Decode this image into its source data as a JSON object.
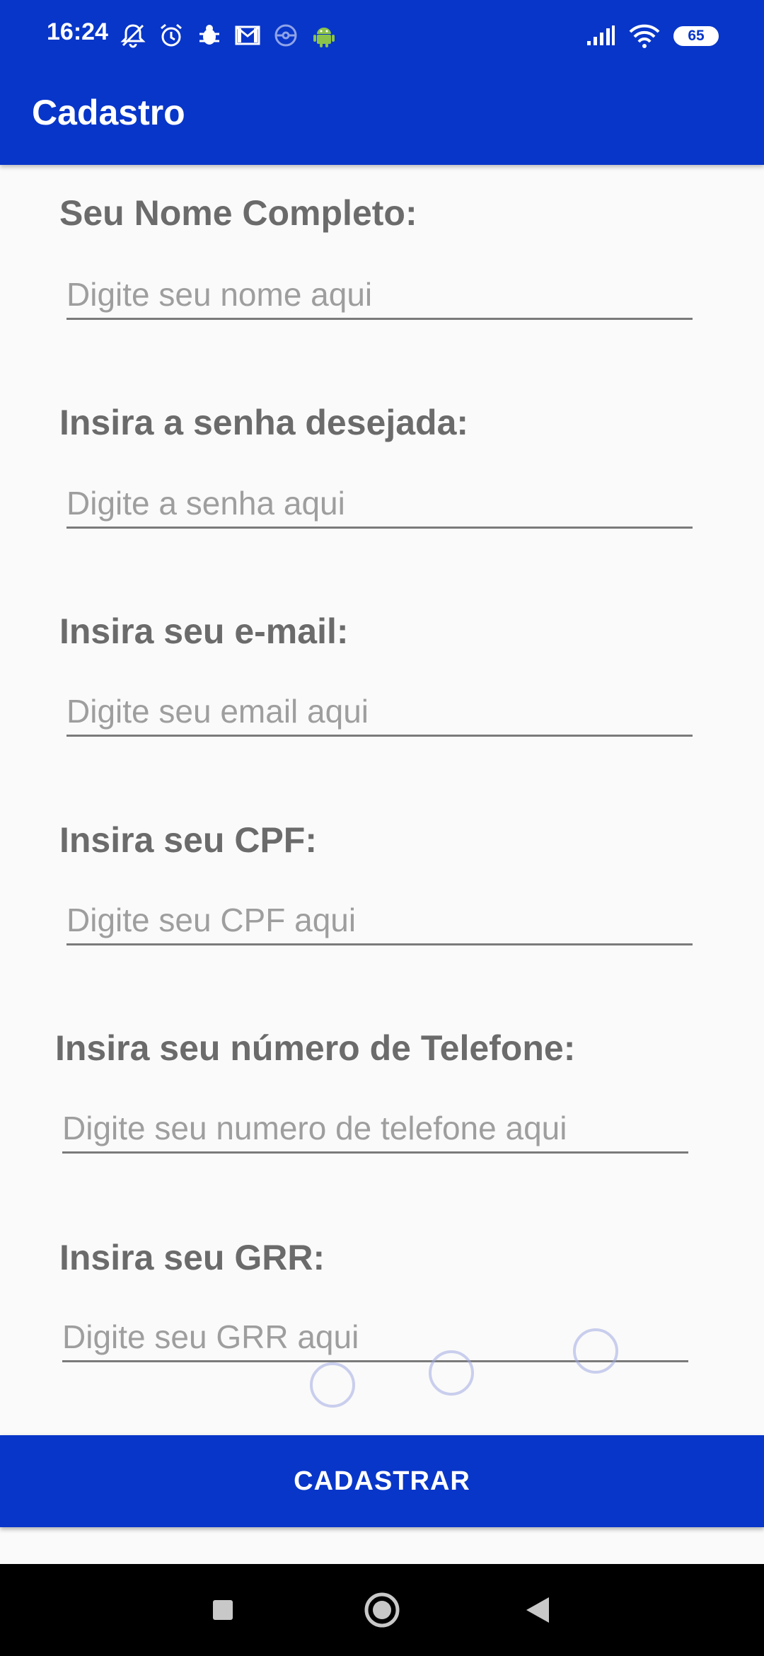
{
  "status_bar": {
    "time": "16:24",
    "left_icons": [
      "mute-icon",
      "alarm-icon",
      "bug-icon",
      "gmail-icon",
      "pokeball-icon",
      "android-icon"
    ],
    "right_icons": [
      "signal-icon",
      "wifi-icon"
    ],
    "battery": "65"
  },
  "app_bar": {
    "title": "Cadastro",
    "color": "#0836c9"
  },
  "form": {
    "fields": [
      {
        "label": "Seu Nome Completo:",
        "placeholder": "Digite seu nome aqui"
      },
      {
        "label": "Insira a senha desejada:",
        "placeholder": "Digite a senha aqui"
      },
      {
        "label": "Insira seu e-mail:",
        "placeholder": "Digite seu email aqui"
      },
      {
        "label": "Insira seu CPF:",
        "placeholder": "Digite seu CPF aqui"
      },
      {
        "label": "Insira seu número de Telefone:",
        "placeholder": "Digite seu numero de telefone aqui"
      },
      {
        "label": "Insira seu GRR:",
        "placeholder": "Digite seu GRR aqui"
      }
    ],
    "submit_label": "CADASTRAR"
  },
  "nav_bar": {
    "buttons": [
      "recents-icon",
      "home-icon",
      "back-icon"
    ]
  }
}
